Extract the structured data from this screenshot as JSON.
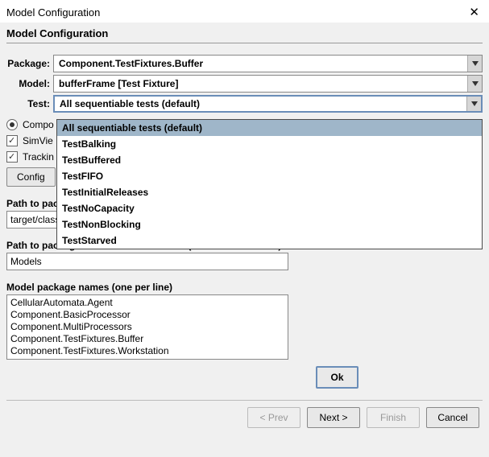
{
  "window": {
    "title": "Model Configuration"
  },
  "section_title": "Model Configuration",
  "form": {
    "package_label": "Package:",
    "package_value": "Component.TestFixtures.Buffer",
    "model_label": "Model:",
    "model_value": "bufferFrame [Test Fixture]",
    "test_label": "Test:",
    "test_value": "All sequentiable tests (default)",
    "test_options": [
      "All sequentiable tests (default)",
      "TestBalking",
      "TestBuffered",
      "TestFIFO",
      "TestInitialReleases",
      "TestNoCapacity",
      "TestNonBlocking",
      "TestStarved"
    ]
  },
  "controls": {
    "compo_label": "Compo",
    "simview_label": "SimVie",
    "tracking_label": "Trackin",
    "config_button": "Config"
  },
  "paths": {
    "classes_label": "Path to packages of model classes (from current folder)",
    "classes_value": "target/classes",
    "sources_label": "Path to packages of model source files (from current folder)",
    "sources_value": "Models",
    "pkgs_label": "Model package names (one per line)",
    "pkgs_values": [
      "CellularAutomata.Agent",
      "Component.BasicProcessor",
      "Component.MultiProcessors",
      "Component.TestFixtures.Buffer",
      "Component.TestFixtures.Workstation"
    ]
  },
  "ok_label": "Ok",
  "nav": {
    "prev": "< Prev",
    "next": "Next >",
    "finish": "Finish",
    "cancel": "Cancel"
  }
}
